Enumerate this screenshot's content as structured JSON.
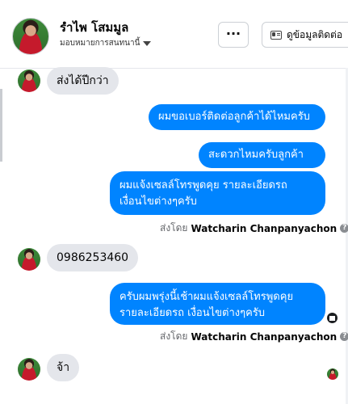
{
  "header": {
    "contact_name": "รำไพ โสมมูล",
    "assign_label": "มอบหมายการสนทนานี้",
    "more_label": "···",
    "contact_info_label": "ดูข้อมูลติดต่อ"
  },
  "messages": {
    "in_1": "ส่งได้ปีกว่า",
    "out_1": "ผมขอเบอร์ติดต่อลูกค้าได้ไหมครับ",
    "out_2": "สะดวกไหมครับลูกค้า",
    "out_3_line1": "ผมแจ้งเซลล์โทรพูดคุย รายละเอียดรถ",
    "out_3_line2": "เงื่อนไขต่างๆครับ",
    "in_2": "0986253460",
    "out_4_line1": "ครับผมพรุ่งนี้เช้าผมแจ้งเซลล์โทรพูดคุย",
    "out_4_line2": "รายละเอียดรถ เงื่อนไขต่างๆครับ",
    "in_3": "จ้า"
  },
  "sent_by": {
    "prefix": "ส่งโดย",
    "agent": "Watcharin Chanpanyachon",
    "help_glyph": "?"
  },
  "colors": {
    "outgoing_bubble": "#0084ff",
    "incoming_bubble": "#e4e6eb"
  },
  "icons": [
    "avatar",
    "chevron-down-icon",
    "more-icon",
    "contact-card-icon",
    "help-icon",
    "seen-status-icon"
  ]
}
